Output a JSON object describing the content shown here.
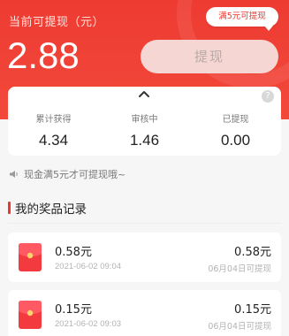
{
  "header": {
    "balance_label": "当前可提现（元）",
    "balance_amount": "2.88",
    "tip_bubble": "满5元可提现",
    "withdraw_label": "提现"
  },
  "stats": {
    "earned": {
      "label": "累计获得",
      "value": "4.34"
    },
    "reviewing": {
      "label": "审核中",
      "value": "1.46"
    },
    "withdrawn": {
      "label": "已提现",
      "value": "0.00"
    },
    "help_icon": "?"
  },
  "notice": "现金满5元才可提现哦~",
  "records_title": "我的奖品记录",
  "records": [
    {
      "title": "0.58元",
      "time": "2021-06-02 09:04",
      "amount": "0.58元",
      "status": "06月04日可提现"
    },
    {
      "title": "0.15元",
      "time": "2021-06-02 09:03",
      "amount": "0.15元",
      "status": "06月04日可提现"
    }
  ],
  "colors": {
    "accent": "#e8392f",
    "header_bg": "#ee3b32"
  },
  "icons": {
    "expand": "chevron-up-icon",
    "help": "question-icon",
    "notice": "speaker-icon",
    "record": "red-envelope-icon"
  }
}
